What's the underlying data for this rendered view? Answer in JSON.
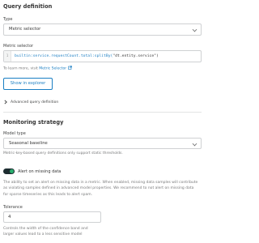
{
  "query_definition": {
    "title": "Query definition",
    "type_label": "Type",
    "type_value": "Metric selector",
    "metric_selector_label": "Metric selector",
    "line_number": "1",
    "code_keyword": "builtin:service.requestCount.total:splitBy(",
    "code_rest": "\"dt.entity.service\")",
    "learn_more_text": "To learn more, visit",
    "learn_more_link": "Metric Selector",
    "show_explorer_label": "Show in explorer",
    "advanced_label": "Advanced query definition"
  },
  "monitoring_strategy": {
    "title": "Monitoring strategy",
    "model_type_label": "Model type",
    "model_type_value": "Seasonal baseline",
    "model_help": "Metric-key-based query definitions only support static thresholds.",
    "alert_label": "Alert on missing data",
    "alert_enabled": true,
    "alert_help_lines": [
      "The ability to set an alert on missing data in a metric. When enabled, missing data samples will contribute",
      "as violating samples defined in advanced model properties. We recommend to not alert on missing data",
      "for sparse timeseries as this leads to alert spam."
    ],
    "tolerance_label": "Tolerance",
    "tolerance_value": "4",
    "tolerance_help_lines": [
      "Controls the width of the confidence band and",
      "larger values lead to a less sensitive model"
    ]
  },
  "colors": {
    "accent": "#1a7ec3",
    "toggle_on": "#2ab06f",
    "toggle_track": "#1d2c30"
  }
}
